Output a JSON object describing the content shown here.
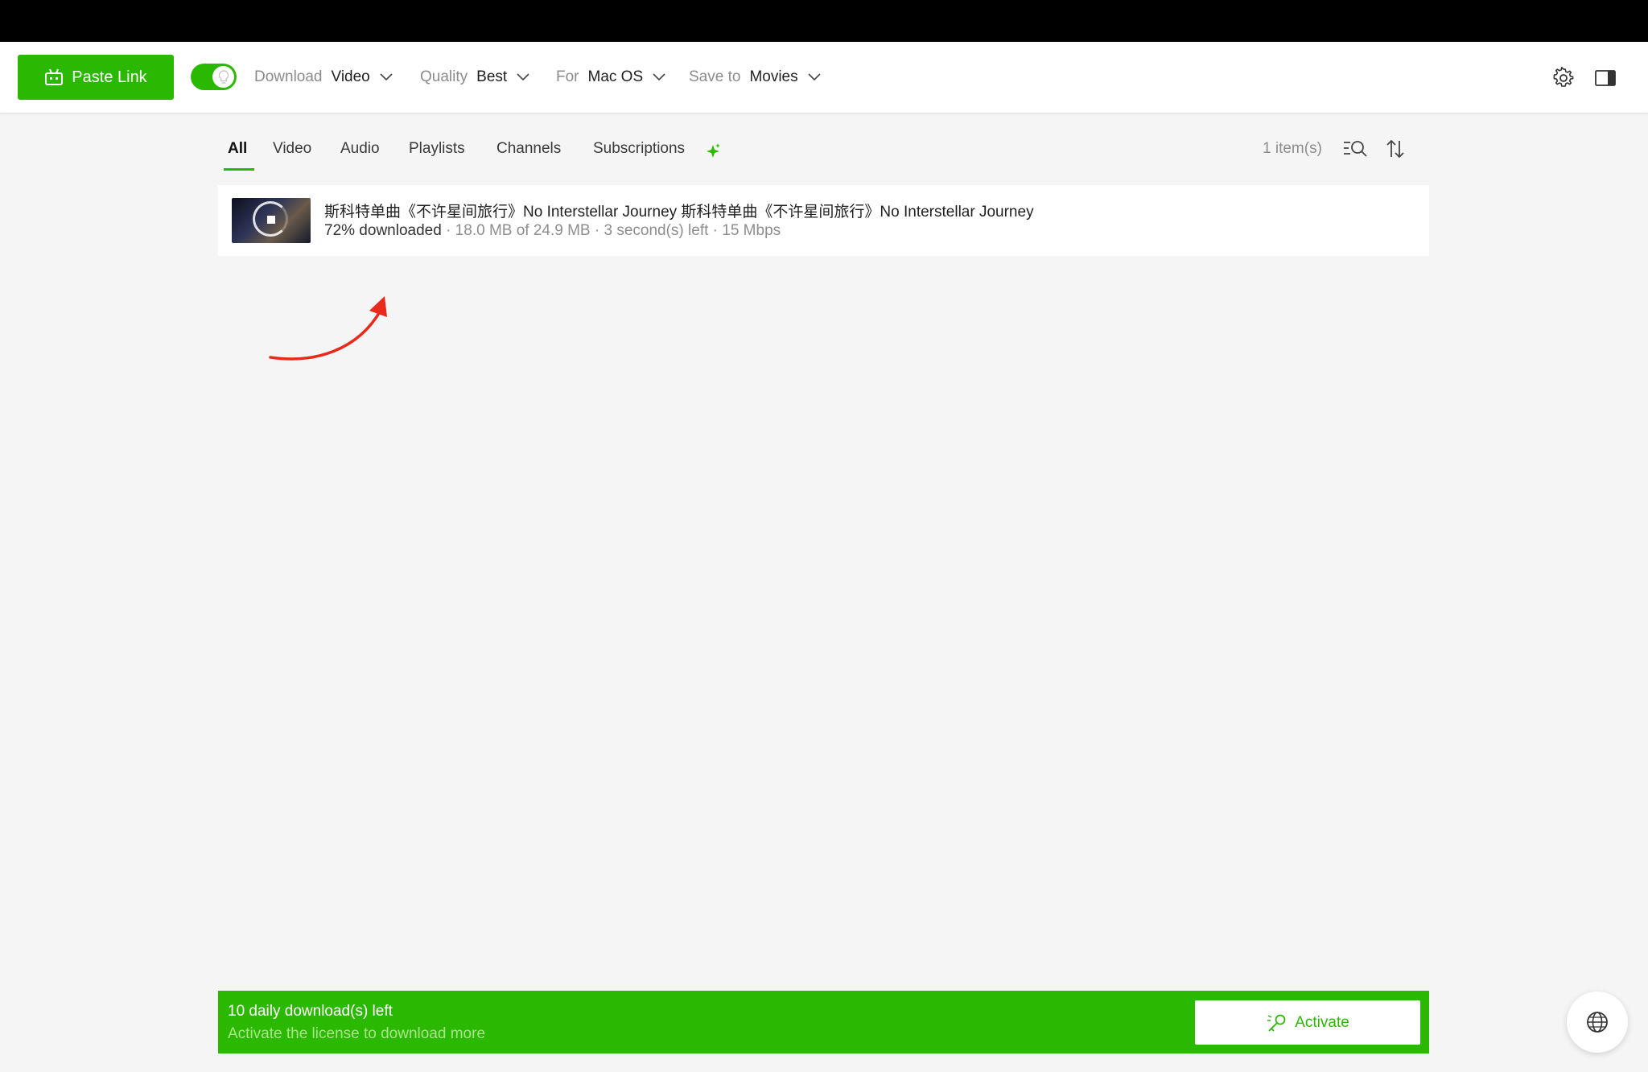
{
  "toolbar": {
    "paste_label": "Paste Link",
    "toggle_on": true,
    "download": {
      "label": "Download",
      "value": "Video"
    },
    "quality": {
      "label": "Quality",
      "value": "Best"
    },
    "platform": {
      "label": "For",
      "value": "Mac OS"
    },
    "save_to": {
      "label": "Save to",
      "value": "Movies"
    },
    "icons": [
      "robot-icon",
      "lightbulb-icon",
      "chevron-down-icon",
      "gear-icon",
      "sidebar-panel-icon"
    ]
  },
  "tabs": [
    {
      "label": "All",
      "active": true
    },
    {
      "label": "Video",
      "active": false
    },
    {
      "label": "Audio",
      "active": false
    },
    {
      "label": "Playlists",
      "active": false
    },
    {
      "label": "Channels",
      "active": false
    },
    {
      "label": "Subscriptions",
      "active": false
    }
  ],
  "list": {
    "count_text": "1 item(s)",
    "items": [
      {
        "title": "斯科特单曲《不许星间旅行》No Interstellar Journey 斯科特单曲《不许星间旅行》No Interstellar Journey",
        "progress_text": "72% downloaded",
        "progress_percent": 72,
        "details": "· 18.0 MB of 24.9 MB · 3 second(s) left · 15 Mbps"
      }
    ]
  },
  "banner": {
    "line1": "10 daily download(s) left",
    "line2": "Activate the license to download more",
    "activate_label": "Activate"
  },
  "colors": {
    "accent": "#2bb800",
    "annotation_arrow": "#e8291b",
    "background": "#f5f5f5"
  }
}
